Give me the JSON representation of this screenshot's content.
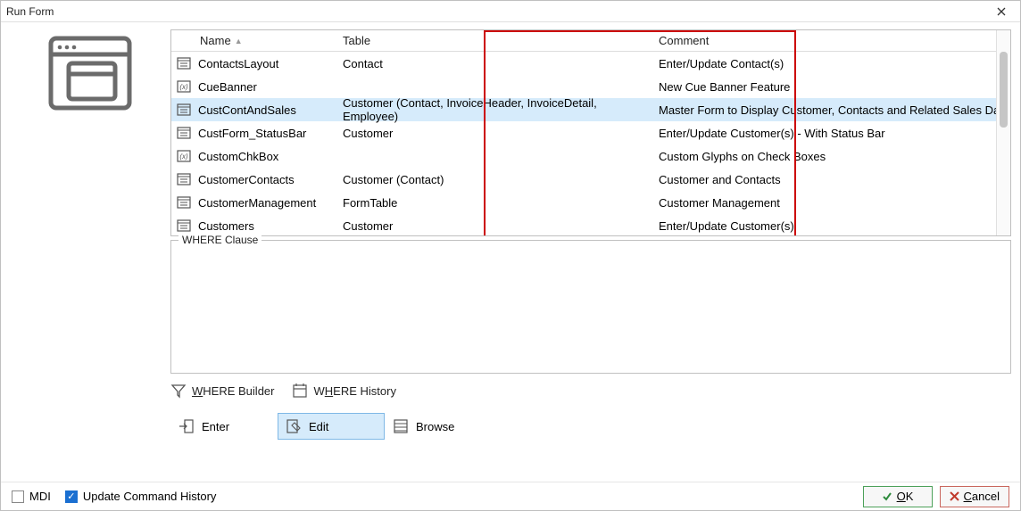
{
  "window": {
    "title": "Run Form"
  },
  "grid": {
    "headers": {
      "name": "Name",
      "table": "Table",
      "comment": "Comment"
    },
    "rows": [
      {
        "icon": "form",
        "name": "ContactsLayout",
        "table": "Contact",
        "comment": "Enter/Update Contact(s)"
      },
      {
        "icon": "fx",
        "name": "CueBanner",
        "table": "",
        "comment": "New Cue Banner Feature"
      },
      {
        "icon": "form",
        "name": "CustContAndSales",
        "table": "Customer (Contact, InvoiceHeader, InvoiceDetail, Employee)",
        "comment": "Master Form to Display Customer, Contacts and Related Sales Data",
        "selected": true
      },
      {
        "icon": "form",
        "name": "CustForm_StatusBar",
        "table": "Customer",
        "comment": "Enter/Update Customer(s) - With Status Bar"
      },
      {
        "icon": "fx",
        "name": "CustomChkBox",
        "table": "",
        "comment": "Custom Glyphs on Check Boxes"
      },
      {
        "icon": "form",
        "name": "CustomerContacts",
        "table": "Customer (Contact)",
        "comment": "Customer and Contacts"
      },
      {
        "icon": "form",
        "name": "CustomerManagement",
        "table": "FormTable",
        "comment": "Customer Management"
      },
      {
        "icon": "form",
        "name": "Customers",
        "table": "Customer",
        "comment": "Enter/Update Customer(s)"
      }
    ]
  },
  "where": {
    "legend": "WHERE Clause",
    "value": ""
  },
  "where_tools": {
    "builder": "WHERE Builder",
    "history": "WHERE History",
    "builder_key": "W",
    "history_key": "H"
  },
  "modes": {
    "enter": {
      "label": "Enter",
      "key": "n"
    },
    "edit": {
      "label": "Edit",
      "key": "E",
      "active": true
    },
    "browse": {
      "label": "Browse",
      "key": "B"
    }
  },
  "status": {
    "mdi": {
      "label": "MDI",
      "key": "M",
      "checked": false
    },
    "history": {
      "label": "Update Command History",
      "key": "U",
      "checked": true
    }
  },
  "buttons": {
    "ok": "OK",
    "cancel": "Cancel",
    "ok_key": "O",
    "cancel_key": "C"
  }
}
